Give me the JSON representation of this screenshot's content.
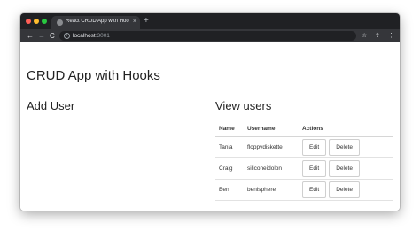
{
  "browser": {
    "tab_title": "React CRUD App with Hooks",
    "tab_close": "×",
    "new_tab": "+",
    "url_host": "localhost",
    "url_port": ":3001",
    "back": "←",
    "forward": "→",
    "reload": "C",
    "info": "i",
    "star": "☆",
    "extension": "⇪",
    "menu": "⋮"
  },
  "page": {
    "title": "CRUD App with Hooks",
    "add_user_heading": "Add User",
    "view_users_heading": "View users"
  },
  "table": {
    "headers": {
      "name": "Name",
      "username": "Username",
      "actions": "Actions"
    },
    "edit_label": "Edit",
    "delete_label": "Delete",
    "rows": [
      {
        "name": "Tania",
        "username": "floppydiskette"
      },
      {
        "name": "Craig",
        "username": "siliconeidolon"
      },
      {
        "name": "Ben",
        "username": "benisphere"
      }
    ]
  }
}
